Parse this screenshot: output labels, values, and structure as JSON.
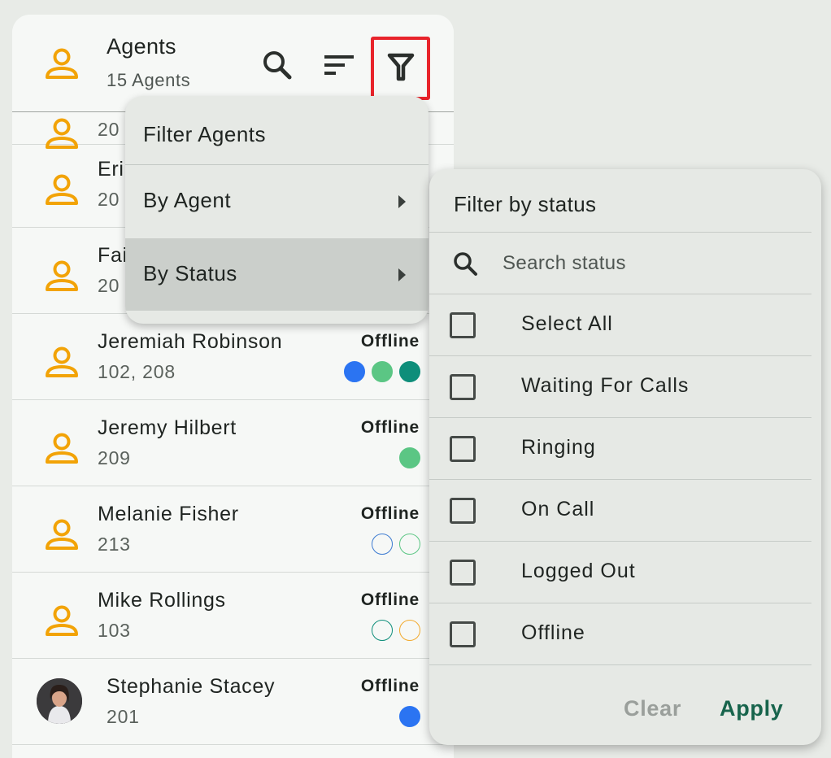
{
  "header": {
    "title": "Agents",
    "subtitle": "15 Agents"
  },
  "agents": [
    {
      "name": "Eri",
      "ext": "20",
      "status": "",
      "dots": []
    },
    {
      "name": "Fai",
      "ext": "20",
      "status": "",
      "dots": []
    },
    {
      "name": "Jeremiah Robinson",
      "ext": "102, 208",
      "status": "Offline",
      "dots": [
        {
          "fill": "#2b74f2",
          "border": "#2b74f2"
        },
        {
          "fill": "#5bc684",
          "border": "#5bc684"
        },
        {
          "fill": "#0e8e7a",
          "border": "#0e8e7a"
        }
      ]
    },
    {
      "name": "Jeremy Hilbert",
      "ext": "209",
      "status": "Offline",
      "dots": [
        {
          "fill": "#5bc684",
          "border": "#5bc684"
        }
      ]
    },
    {
      "name": "Melanie Fisher",
      "ext": "213",
      "status": "Offline",
      "dots": [
        {
          "fill": "transparent",
          "border": "#3d7bd1"
        },
        {
          "fill": "transparent",
          "border": "#5bc684"
        }
      ]
    },
    {
      "name": "Mike Rollings",
      "ext": "103",
      "status": "Offline",
      "dots": [
        {
          "fill": "transparent",
          "border": "#0e8e7a"
        },
        {
          "fill": "transparent",
          "border": "#f2a92c"
        }
      ]
    },
    {
      "name": "Stephanie Stacey",
      "ext": "201",
      "status": "Offline",
      "dots": [
        {
          "fill": "#2b74f2",
          "border": "#2b74f2"
        }
      ]
    }
  ],
  "partial_row_ext": "20",
  "filter_menu": {
    "title": "Filter Agents",
    "items": [
      {
        "label": "By Agent"
      },
      {
        "label": "By Status"
      }
    ]
  },
  "status_panel": {
    "title": "Filter by status",
    "search_placeholder": "Search status",
    "options": [
      "Select All",
      "Waiting For Calls",
      "Ringing",
      "On Call",
      "Logged Out",
      "Offline"
    ],
    "clear_label": "Clear",
    "apply_label": "Apply"
  },
  "colors": {
    "accent": "#f2a307",
    "apply": "#17644c",
    "highlight": "#e8242b"
  },
  "icons": {
    "agent": "person-icon",
    "search": "search-icon",
    "sort": "sort-icon",
    "filter": "filter-icon",
    "submenu": "chevron-right-icon"
  }
}
